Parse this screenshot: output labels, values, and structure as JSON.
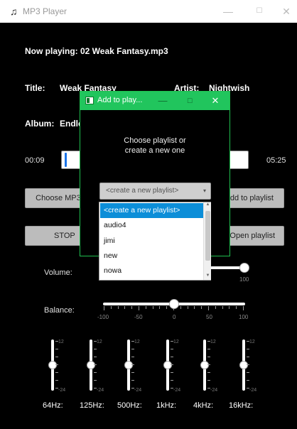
{
  "window": {
    "title": "MP3 Player",
    "app_icon": "music-note-icon",
    "minimize": "—",
    "maximize": "☐",
    "close": "✕"
  },
  "now_playing": "Now playing: 02 Weak Fantasy.mp3",
  "track_info": {
    "title_label": "Title:",
    "title_value": "Weak Fantasy",
    "artist_label": "Artist:",
    "artist_value": "Nightwish",
    "album_label": "Album:",
    "album_value": "Endle"
  },
  "progress": {
    "current": "00:09",
    "total": "05:25"
  },
  "buttons": {
    "choose_mp3": "Choose MP3 f",
    "add_to_playlist": "dd to playlist",
    "stop": "STOP",
    "open_playlist": "Open playlist"
  },
  "volume": {
    "label": "Volume:",
    "max_label": "100",
    "level_percent": 100
  },
  "balance": {
    "label": "Balance:",
    "ticks": [
      "-100",
      "-50",
      "0",
      "50",
      "100"
    ],
    "value": 0
  },
  "equalizer": {
    "bands": [
      {
        "label": "64Hz:",
        "top": "12",
        "bottom": "-24"
      },
      {
        "label": "125Hz:",
        "top": "12",
        "bottom": "-24"
      },
      {
        "label": "500Hz:",
        "top": "12",
        "bottom": "-24"
      },
      {
        "label": "1kHz:",
        "top": "12",
        "bottom": "-24"
      },
      {
        "label": "4kHz:",
        "top": "12",
        "bottom": "-24"
      },
      {
        "label": "16kHz:",
        "top": "12",
        "bottom": "-24"
      }
    ]
  },
  "dialog": {
    "title": "Add to play...",
    "minimize": "—",
    "maximize": "☐",
    "close": "✕",
    "message_line1": "Choose playlist or",
    "message_line2": "create a new one",
    "combo_value": "<create a new playlist>",
    "options": [
      "<create a new playlist>",
      "audio4",
      "jimi",
      "new",
      "nowa"
    ],
    "selected_index": 0
  },
  "colors": {
    "dialog_title_bg": "#21c55d",
    "selection": "#0c8ed8",
    "progress_marker": "#1a73e8"
  }
}
